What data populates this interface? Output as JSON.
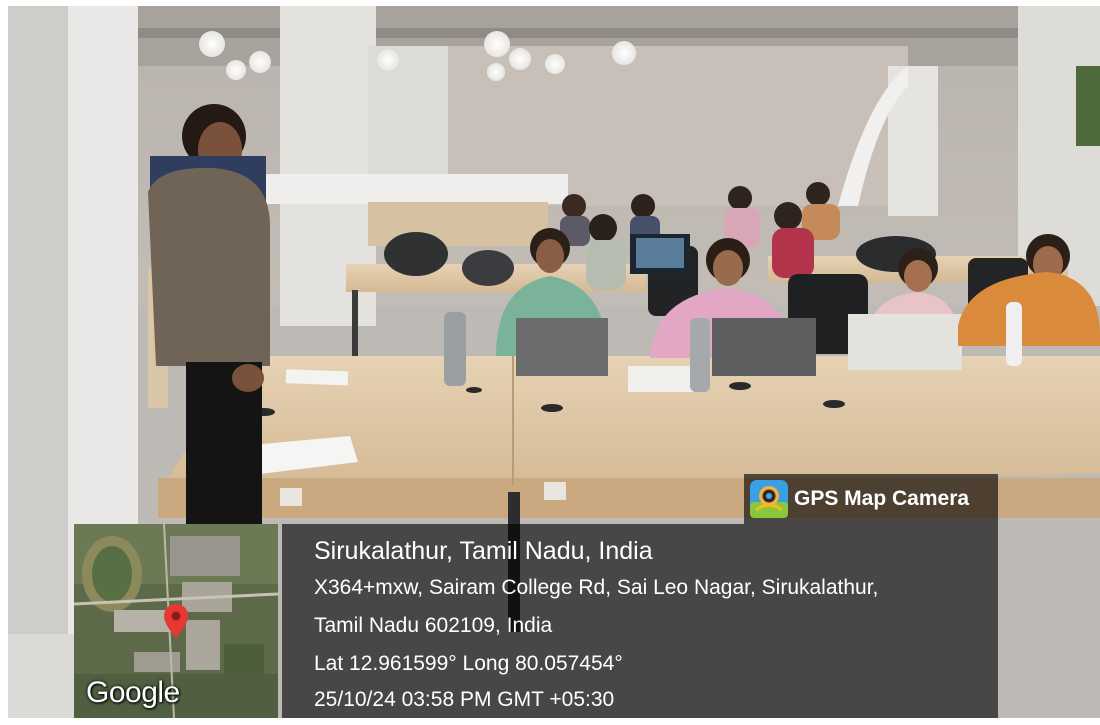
{
  "overlay": {
    "app_name": "GPS Map Camera",
    "app_icon": "gps-map-camera-icon",
    "map_provider": "Google",
    "location_title": "Sirukalathur, Tamil Nadu, India",
    "address_line_1": "X364+mxw, Sairam College Rd, Sai Leo Nagar, Sirukalathur,",
    "address_line_2": "Tamil Nadu 602109, India",
    "coordinates": "Lat 12.961599° Long 80.057454°",
    "timestamp": "25/10/24 03:58 PM GMT +05:30",
    "pin_icon": "map-pin-icon",
    "panel_color": "#000000",
    "pin_color": "#e53935"
  }
}
